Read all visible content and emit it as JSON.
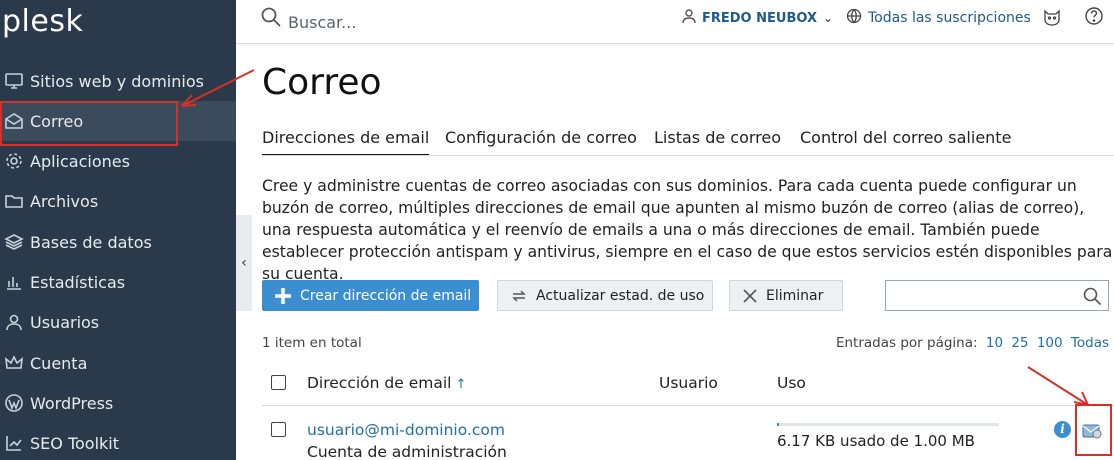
{
  "app": {
    "logo": "plesk"
  },
  "sidebar": {
    "items": [
      {
        "label": "Sitios web y dominios",
        "icon": "monitor-icon"
      },
      {
        "label": "Correo",
        "icon": "mail-icon",
        "active": true
      },
      {
        "label": "Aplicaciones",
        "icon": "gear-icon"
      },
      {
        "label": "Archivos",
        "icon": "folder-icon"
      },
      {
        "label": "Bases de datos",
        "icon": "database-icon"
      },
      {
        "label": "Estadísticas",
        "icon": "bar-chart-icon"
      },
      {
        "label": "Usuarios",
        "icon": "user-icon"
      },
      {
        "label": "Cuenta",
        "icon": "crown-icon"
      },
      {
        "label": "WordPress",
        "icon": "wordpress-icon"
      },
      {
        "label": "SEO Toolkit",
        "icon": "seo-chart-icon"
      }
    ],
    "collapse_glyph": "‹"
  },
  "topbar": {
    "search_placeholder": "Buscar...",
    "user_name": "FREDO NEUBOX",
    "user_caret": "⌄",
    "subscriptions": "Todas las suscripciones"
  },
  "main": {
    "title": "Correo",
    "tabs": [
      {
        "label": "Direcciones de email",
        "active": true
      },
      {
        "label": "Configuración de correo"
      },
      {
        "label": "Listas de correo"
      },
      {
        "label": "Control del correo saliente"
      }
    ],
    "description": "Cree y administre cuentas de correo asociadas con sus dominios. Para cada cuenta puede configurar un buzón de correo, múltiples direcciones de email que apunten al mismo buzón de correo (alias de correo), una respuesta automática y el reenvío de emails a una o más direcciones de email. También puede establecer protección antispam y antivirus, siempre en el caso de que estos servicios estén disponibles para su cuenta.",
    "toolbar": {
      "create_label": "Crear dirección de email",
      "update_label": "Actualizar estad. de uso",
      "delete_label": "Eliminar"
    },
    "list": {
      "total": "1 item en total",
      "per_page_label": "Entradas por página:",
      "per_page_options": [
        "10",
        "25",
        "100",
        "Todas"
      ],
      "columns": {
        "email": "Dirección de email",
        "sort_glyph": "↑",
        "user": "Usuario",
        "usage": "Uso"
      },
      "rows": [
        {
          "email": "usuario@mi-dominio.com",
          "subtitle": "Cuenta de administración",
          "usage": "6.17 KB usado de 1.00 MB",
          "usage_fraction": 0.006
        }
      ]
    }
  },
  "colors": {
    "sidebar_bg": "#2b3a4a",
    "accent": "#3b8fd0",
    "link": "#1f6fae",
    "annotation": "#d93025"
  }
}
